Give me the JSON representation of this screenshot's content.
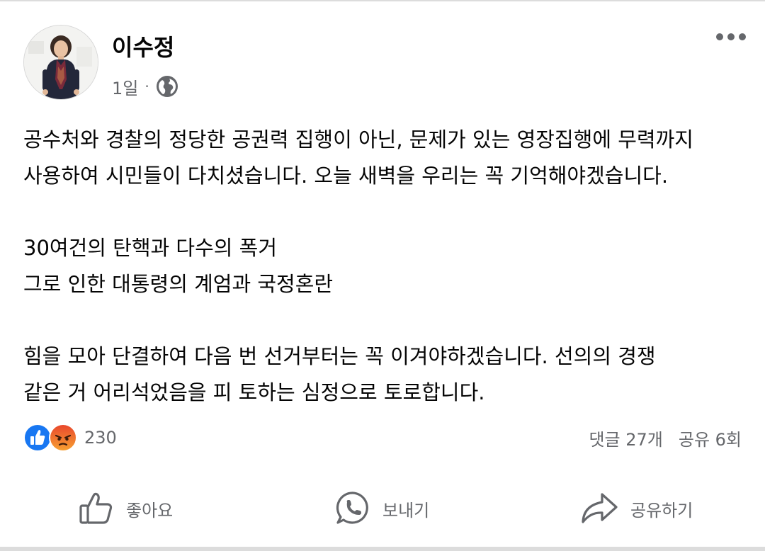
{
  "post": {
    "author_name": "이수정",
    "time": "1일",
    "meta_separator": "·",
    "audience_icon": "globe-icon",
    "menu_icon": "more-options-icon",
    "body": {
      "paragraph1": [
        "공수처와 경찰의 정당한 공권력 집행이 아닌, 문제가 있는 영장집행에 무력까지",
        "사용하여 시민들이 다치셨습니다. 오늘 새벽을 우리는 꼭 기억해야겠습니다."
      ],
      "paragraph2": [
        "30여건의 탄핵과 다수의 폭거",
        "그로 인한 대통령의 계엄과 국정혼란"
      ],
      "paragraph3": [
        "힘을 모아 단결하여 다음 번 선거부터는 꼭 이겨야하겠습니다. 선의의 경쟁",
        "같은 거 어리석었음을 피 토하는 심정으로 토로합니다."
      ]
    }
  },
  "engagement": {
    "reaction_icons": [
      "like-reaction-icon",
      "angry-reaction-icon"
    ],
    "reaction_count": "230",
    "comments": "댓글 27개",
    "shares": "공유 6회"
  },
  "actions": {
    "like_label": "좋아요",
    "send_label": "보내기",
    "share_label": "공유하기"
  },
  "colors": {
    "text_primary": "#050505",
    "text_secondary": "#65676b",
    "like_blue": "#1877f2",
    "angry_orange": "#f06b22",
    "divider": "#dcdcdc"
  }
}
